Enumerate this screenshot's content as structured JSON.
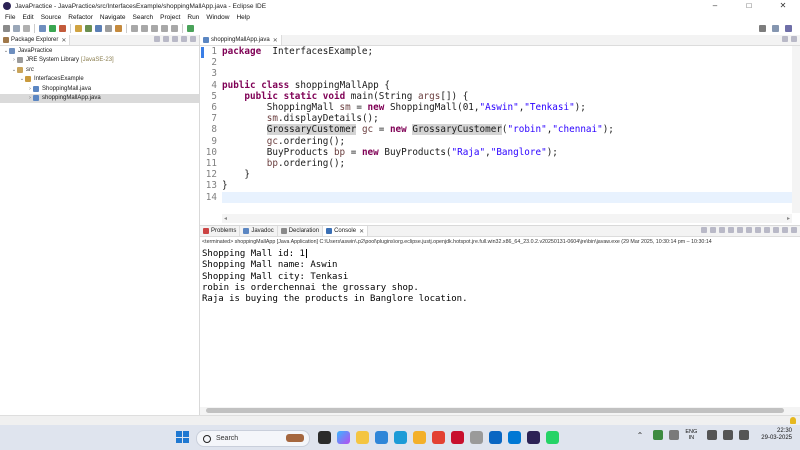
{
  "window": {
    "title": "JavaPractice - JavaPractice/src/InterfacesExample/shoppingMallApp.java - Eclipse IDE",
    "controls": [
      "–",
      "□",
      "✕"
    ]
  },
  "menu": [
    "File",
    "Edit",
    "Source",
    "Refactor",
    "Navigate",
    "Search",
    "Project",
    "Run",
    "Window",
    "Help"
  ],
  "package_explorer": {
    "tab_label": "Package Explorer",
    "tree": [
      {
        "label": "JavaPractice",
        "decoration": ""
      },
      {
        "label": "JRE System Library",
        "decoration": "[JavaSE-23]"
      },
      {
        "label": "src",
        "decoration": ""
      },
      {
        "label": "InterfacesExample",
        "decoration": ""
      },
      {
        "label": "ShoppingMall.java",
        "decoration": ""
      },
      {
        "label": "shoppingMallApp.java",
        "decoration": ""
      }
    ]
  },
  "editor": {
    "tab_label": "shoppingMallApp.java",
    "line_numbers": [
      "1",
      "2",
      "3",
      "4",
      "5",
      "6",
      "7",
      "8",
      "9",
      "10",
      "11",
      "12",
      "13",
      "14"
    ],
    "lines": [
      [
        [
          "kw",
          "package"
        ],
        [
          "",
          "  InterfacesExample;"
        ]
      ],
      [],
      [],
      [
        [
          "kw",
          "public"
        ],
        [
          "",
          " "
        ],
        [
          "kw",
          "class"
        ],
        [
          "",
          " shoppingMallApp {"
        ]
      ],
      [
        [
          "",
          "    "
        ],
        [
          "kw",
          "public"
        ],
        [
          "",
          " "
        ],
        [
          "kw",
          "static"
        ],
        [
          "",
          " "
        ],
        [
          "kw",
          "void"
        ],
        [
          "",
          " main(String "
        ],
        [
          "var",
          "args"
        ],
        [
          "",
          "[]) {"
        ]
      ],
      [
        [
          "",
          "        ShoppingMall "
        ],
        [
          "var",
          "sm"
        ],
        [
          "",
          " = "
        ],
        [
          "kw",
          "new"
        ],
        [
          "",
          " ShoppingMall(01,"
        ],
        [
          "str",
          "\"Aswin\""
        ],
        [
          "",
          ","
        ],
        [
          "str",
          "\"Tenkasi\""
        ],
        [
          "",
          ");"
        ]
      ],
      [
        [
          "",
          "        "
        ],
        [
          "var",
          "sm"
        ],
        [
          "",
          ".displayDetails();"
        ]
      ],
      [
        [
          "",
          "        "
        ],
        [
          "hl",
          "GrossaryCustomer"
        ],
        [
          "",
          " "
        ],
        [
          "var",
          "gc"
        ],
        [
          "",
          " = "
        ],
        [
          "kw",
          "new"
        ],
        [
          "",
          " "
        ],
        [
          "hl",
          "GrossaryCustomer"
        ],
        [
          "",
          "("
        ],
        [
          "str",
          "\"robin\""
        ],
        [
          "",
          ","
        ],
        [
          "str",
          "\"chennai\""
        ],
        [
          "",
          ");"
        ]
      ],
      [
        [
          "",
          "        "
        ],
        [
          "var",
          "gc"
        ],
        [
          "",
          ".ordering();"
        ]
      ],
      [
        [
          "",
          "        BuyProducts "
        ],
        [
          "var",
          "bp"
        ],
        [
          "",
          " = "
        ],
        [
          "kw",
          "new"
        ],
        [
          "",
          " BuyProducts("
        ],
        [
          "str",
          "\"Raja\""
        ],
        [
          "",
          ","
        ],
        [
          "str",
          "\"Banglore\""
        ],
        [
          "",
          ");"
        ]
      ],
      [
        [
          "",
          "        "
        ],
        [
          "var",
          "bp"
        ],
        [
          "",
          ".ordering();"
        ]
      ],
      [
        [
          "",
          "    }"
        ]
      ],
      [
        [
          "",
          "}"
        ]
      ],
      []
    ]
  },
  "bottom_panel": {
    "tabs": [
      "Problems",
      "Javadoc",
      "Declaration",
      "Console"
    ],
    "terminated_line": "<terminated> shoppingMallApp [Java Application] C:\\Users\\aswin\\.p2\\pool\\plugins\\org.eclipse.justj.openjdk.hotspot.jre.full.win32.x86_64_23.0.2.v20250131-0604\\jre\\bin\\javaw.exe  (29 Mar 2025, 10:30:14 pm – 10:30:14",
    "console_output": [
      "Shopping Mall id: 1",
      "Shopping Mall name: Aswin",
      "Shopping Mall city: Tenkasi",
      "robin is orderchennai the grossary shop.",
      "Raja is buying the products in Banglore location."
    ]
  },
  "taskbar": {
    "search_placeholder": "Search",
    "language": [
      "ENG",
      "IN"
    ],
    "time": "22:30",
    "date": "29-03-2025"
  },
  "colors": {
    "keyword": "#7f0055",
    "string": "#2a00ff",
    "variable": "#6a3e3e",
    "accent": "#3a7ee6"
  }
}
